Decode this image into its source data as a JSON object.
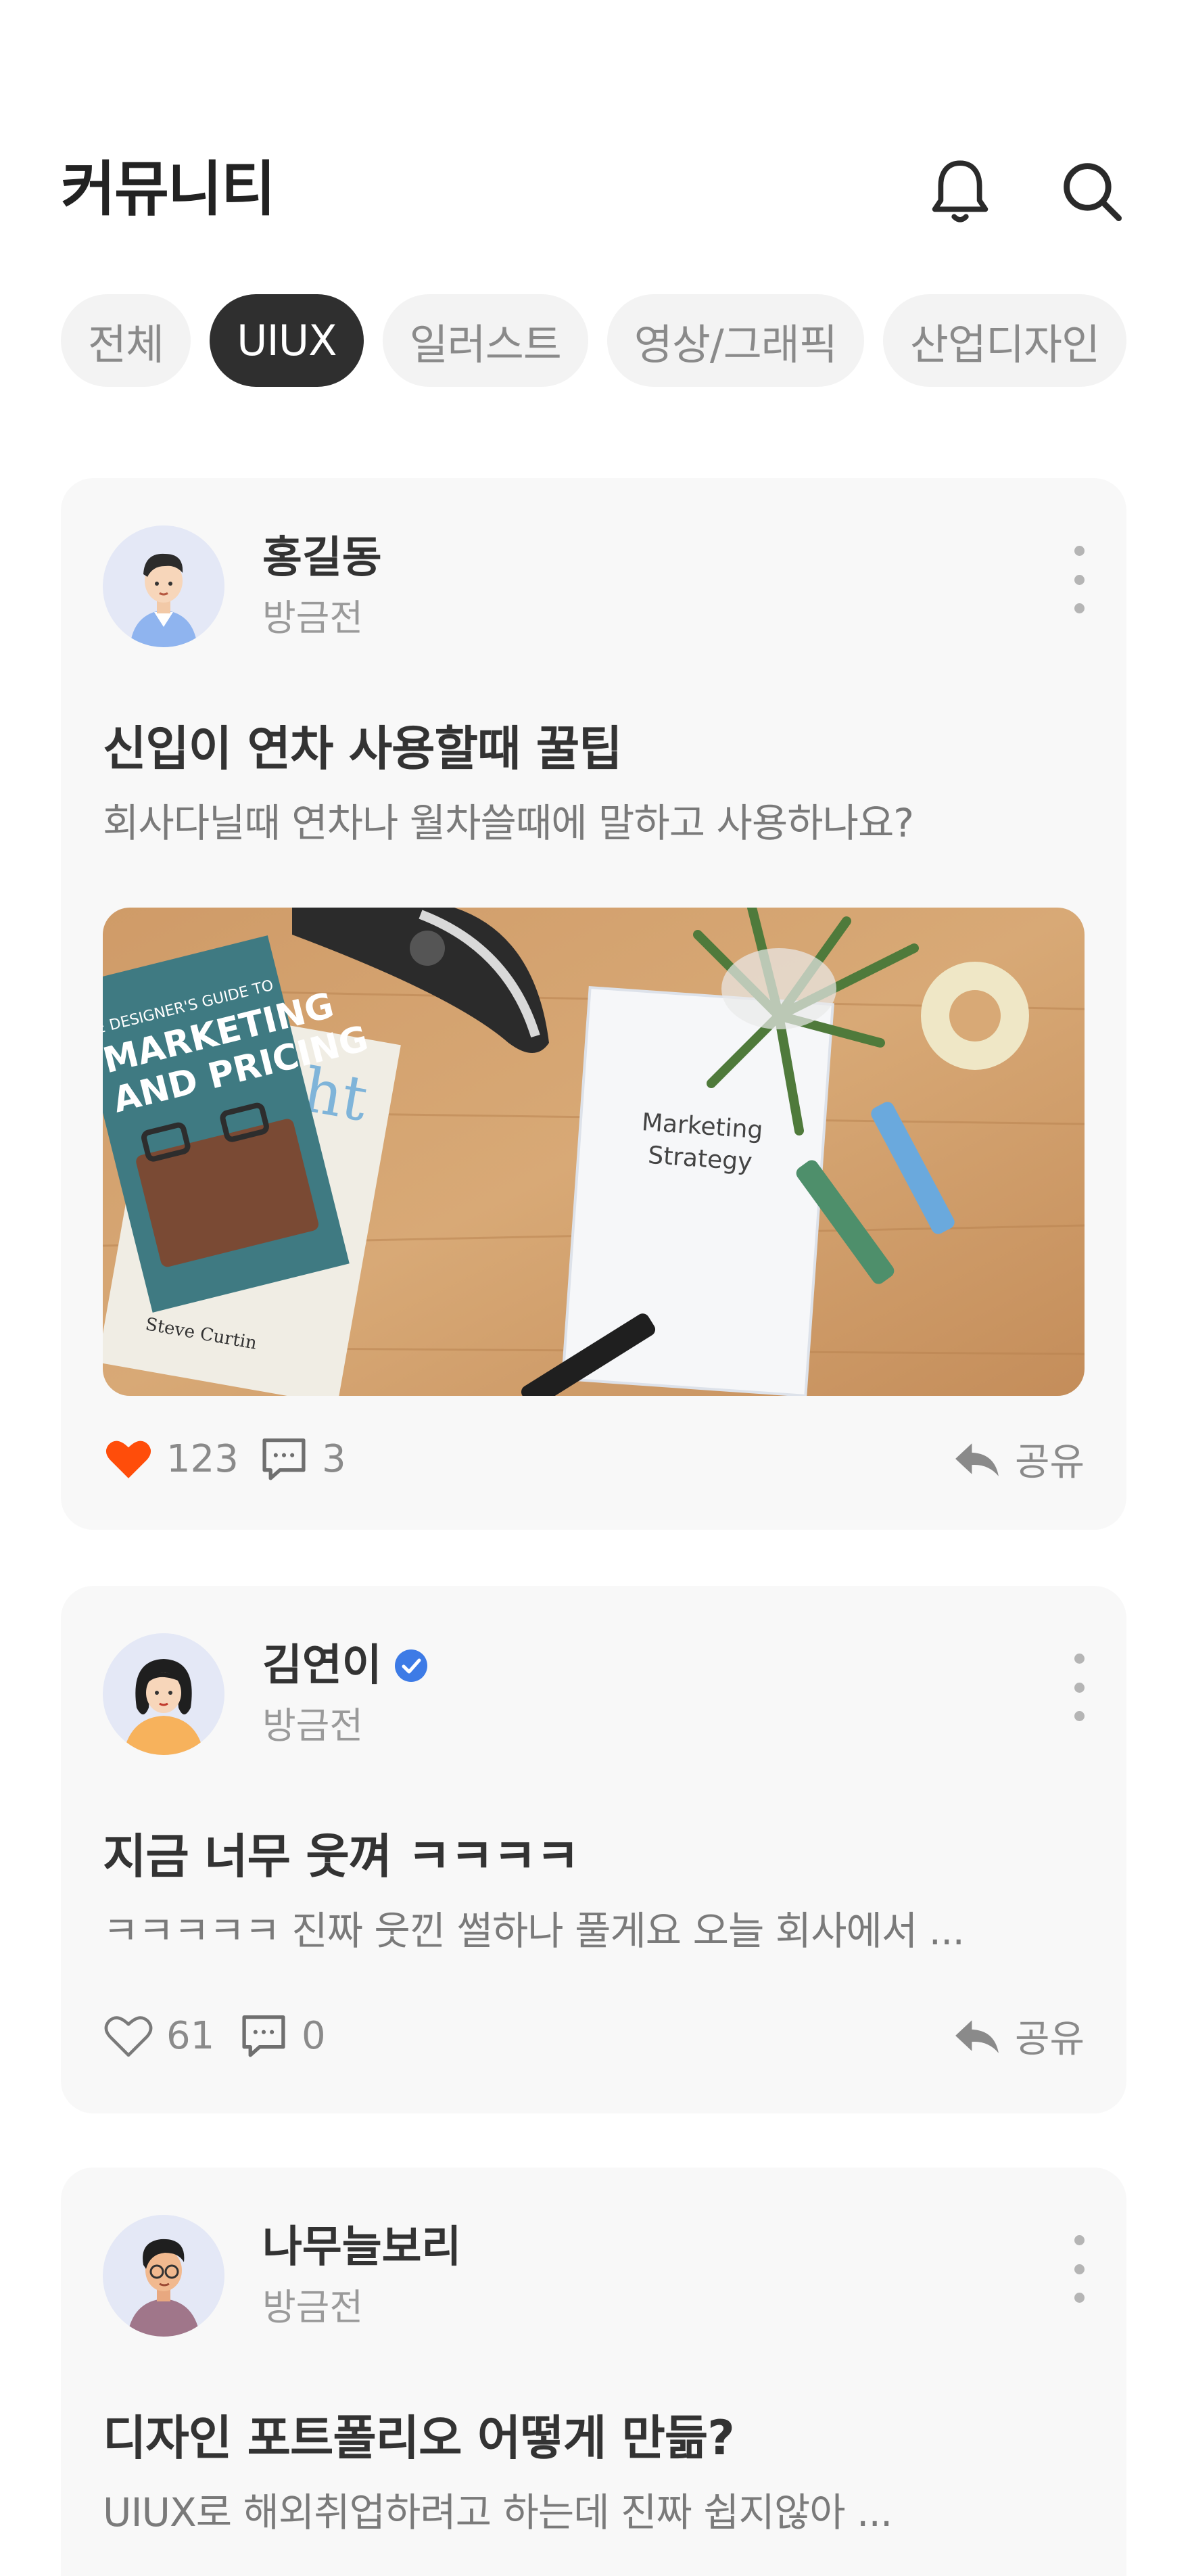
{
  "header": {
    "title": "커뮤니티",
    "bell_icon": "bell-icon",
    "search_icon": "search-icon"
  },
  "categories": [
    {
      "label": "전체",
      "active": false
    },
    {
      "label": "UIUX",
      "active": true
    },
    {
      "label": "일러스트",
      "active": false
    },
    {
      "label": "영상/그래픽",
      "active": false
    },
    {
      "label": "산업디자인",
      "active": false
    }
  ],
  "posts": [
    {
      "author": "홍길동",
      "verified": false,
      "time": "방금전",
      "title": "신입이 연차 사용할때 꿀팁",
      "body": "회사다닐때 연차나 월차쓸때에 말하고 사용하나요?",
      "image_text": [
        "Marketing",
        "Strategy"
      ],
      "book_text": [
        "E DESIGNER'S GUIDE TO",
        "MARKETING",
        "AND PRICING",
        "ht",
        "Steve Curtin"
      ],
      "likes": "123",
      "liked": true,
      "comments": "3",
      "share_label": "공유"
    },
    {
      "author": "김연이",
      "verified": true,
      "time": "방금전",
      "title": "지금 너무 웃껴 ㅋㅋㅋㅋ",
      "body": "ㅋㅋㅋㅋㅋ 진짜 웃낀 썰하나 풀게요 오늘 회사에서 ...",
      "likes": "61",
      "liked": false,
      "comments": "0",
      "share_label": "공유"
    },
    {
      "author": "나무늘보리",
      "verified": false,
      "time": "방금전",
      "title": "디자인 포트폴리오 어떻게 만듦?",
      "body": "UIUX로 해외취업하려고 하는데 진짜 쉽지않아 ..."
    }
  ],
  "colors": {
    "accent_like": "#ff4d0a",
    "chip_active_bg": "#2f2f2f",
    "card_bg": "#f8f8f8",
    "verified": "#3d7be6"
  }
}
